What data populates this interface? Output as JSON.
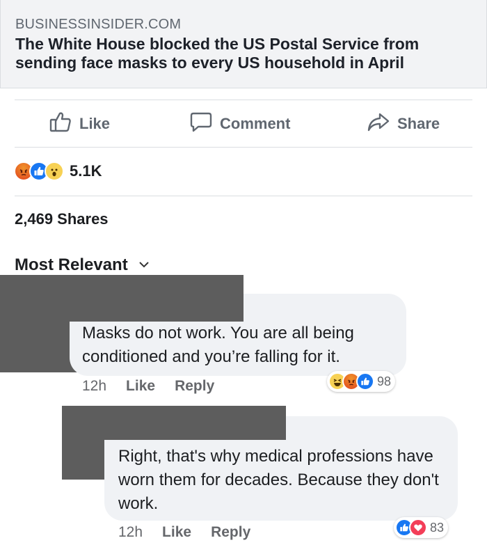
{
  "link": {
    "domain": "BUSINESSINSIDER.COM",
    "title": "The White House blocked the US Postal Service from sending face masks to every US household in April"
  },
  "actions": {
    "like": "Like",
    "comment": "Comment",
    "share": "Share"
  },
  "reactions": {
    "icons": [
      "angry-icon",
      "like-icon",
      "wow-icon"
    ],
    "count": "5.1K"
  },
  "shares": "2,469 Shares",
  "sort": {
    "label": "Most Relevant"
  },
  "comments": [
    {
      "text": "Masks do not work. You are all being conditioned and you’re falling for it.",
      "time": "12h",
      "like": "Like",
      "reply": "Reply",
      "reactions": [
        "haha-icon",
        "angry-icon",
        "like-icon"
      ],
      "reaction_count": "98"
    },
    {
      "text": "Right, that's why medical professions have worn them for decades. Because they don't work.",
      "time": "12h",
      "like": "Like",
      "reply": "Reply",
      "reactions": [
        "like-icon",
        "love-icon"
      ],
      "reaction_count": "83"
    }
  ],
  "colors": {
    "like_blue": "#1877f2",
    "love_red": "#f33e58",
    "angry_orange": "#e0421e",
    "wow_yellow": "#f7d154",
    "redaction_gray": "#5d5d5d"
  }
}
